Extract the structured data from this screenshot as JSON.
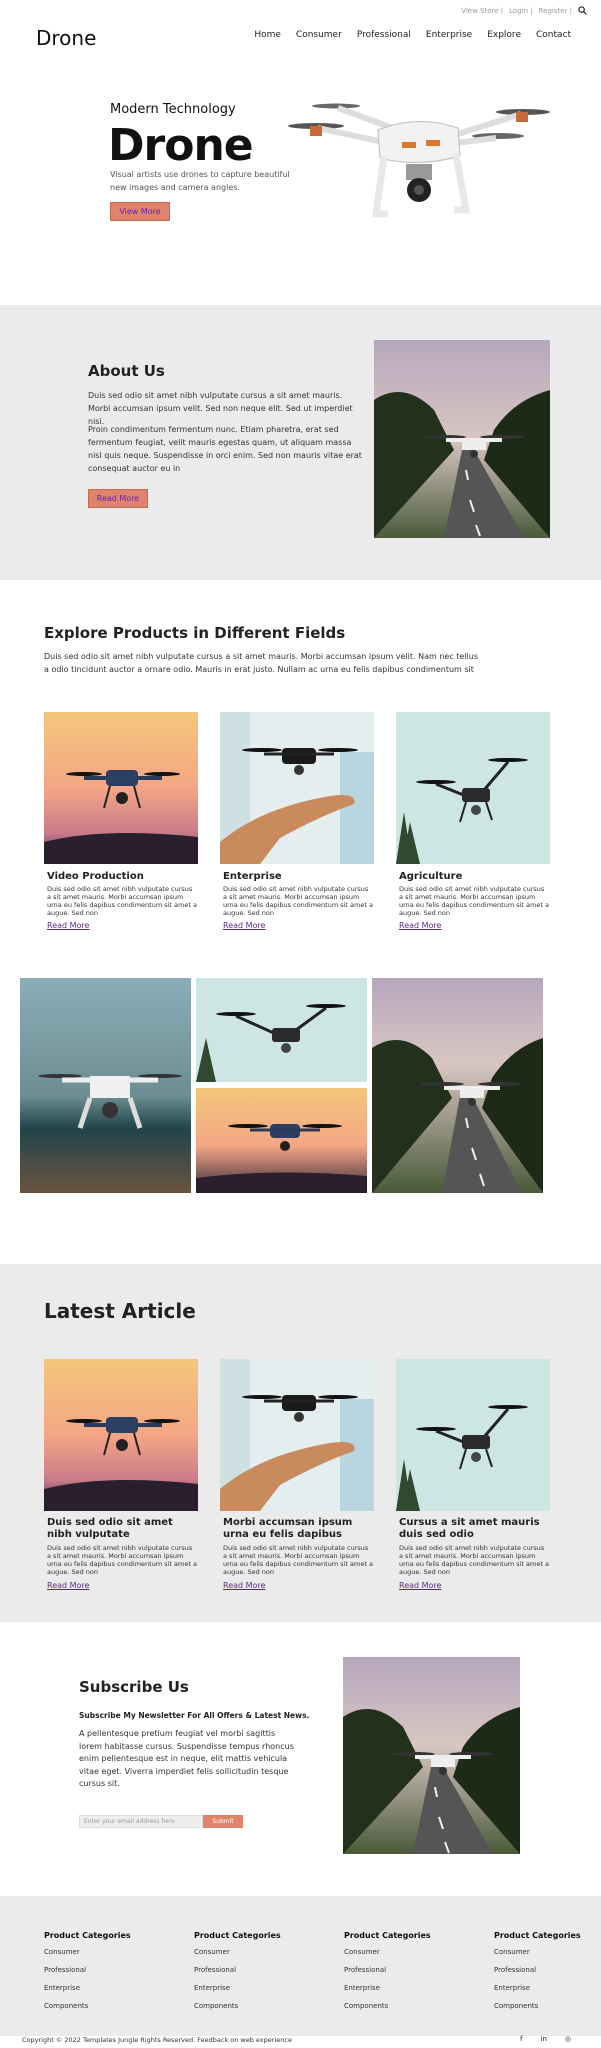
{
  "topbar": {
    "links": [
      "View Store |",
      "Login |",
      "Register |"
    ],
    "icon": "search-icon"
  },
  "brand": "Drone",
  "nav": [
    "Home",
    "Consumer",
    "Professional",
    "Enterprise",
    "Explore",
    "Contact"
  ],
  "hero": {
    "subtitle": "Modern Technology",
    "title": "Drone",
    "description": "Visual artists use drones to capture beautiful new images and camera angles.",
    "button": "View More"
  },
  "about": {
    "title": "About Us",
    "p1": "Duis sed odio sit amet nibh vulputate cursus a sit amet mauris. Morbi accumsan ipsum velit. Sed non neque elit. Sed ut imperdiet nisi.",
    "p2": "Proin condimentum fermentum nunc. Etiam pharetra, erat sed fermentum feugiat, velit mauris egestas quam, ut aliquam massa nisl quis neque. Suspendisse in orci enim. Sed non mauris vitae erat consequat auctor eu in",
    "button": "Read More"
  },
  "explore": {
    "title": "Explore Products in Different Fields",
    "description": "Duis sed odio sit amet nibh vulputate cursus a sit amet mauris. Morbi accumsan ipsum velit. Nam nec tellus a odio tincidunt auctor a ornare odio. Mauris in erat justo. Nullam ac urna eu felis dapibus condimentum sit",
    "cards": [
      {
        "title": "Video Production",
        "text": "Duis sed odio sit amet nibh vulputate cursus a sit amet mauris. Morbi accumsan ipsum urna eu felis dapibus condimentum sit amet a augue. Sed non",
        "link": "Read More"
      },
      {
        "title": "Enterprise",
        "text": "Duis sed odio sit amet nibh vulputate cursus a sit amet mauris. Morbi accumsan ipsum urna eu felis dapibus condimentum sit amet a augue. Sed non",
        "link": "Read More"
      },
      {
        "title": "Agriculture",
        "text": "Duis sed odio sit amet nibh vulputate cursus a sit amet mauris. Morbi accumsan ipsum urna eu felis dapibus condimentum sit amet a augue. Sed non",
        "link": "Read More"
      }
    ]
  },
  "latest": {
    "title": "Latest Article",
    "articles": [
      {
        "title": "Duis sed odio sit amet nibh vulputate",
        "text": "Duis sed odio sit amet nibh vulputate cursus a sit amet mauris. Morbi accumsan ipsum urna eu felis dapibus condimentum sit amet a augue. Sed non",
        "link": "Read More"
      },
      {
        "title": "Morbi accumsan ipsum urna eu felis dapibus",
        "text": "Duis sed odio sit amet nibh vulputate cursus a sit amet mauris. Morbi accumsan ipsum urna eu felis dapibus condimentum sit amet a augue. Sed non",
        "link": "Read More"
      },
      {
        "title": "Cursus a sit amet mauris duis sed odio",
        "text": "Duis sed odio sit amet nibh vulputate cursus a sit amet mauris. Morbi accumsan ipsum urna eu felis dapibus condimentum sit amet a augue. Sed non",
        "link": "Read More"
      }
    ]
  },
  "subscribe": {
    "title": "Subscribe Us",
    "lead": "Subscribe My Newsletter For All Offers & Latest News.",
    "text": "A pellentesque pretium feugiat vel morbi sagittis lorem habitasse cursus. Suspendisse tempus rhoncus enim pellentesque est in neque, elit mattis vehicula vitae eget. Viverra imperdiet felis sollicitudin tesque cursus sit.",
    "placeholder": "Enter your email address here",
    "button": "Submit"
  },
  "footer": {
    "columns": [
      {
        "heading": "Product Categories",
        "items": [
          "Consumer",
          "Professional",
          "Enterprise",
          "Components"
        ]
      },
      {
        "heading": "Product Categories",
        "items": [
          "Consumer",
          "Professional",
          "Enterprise",
          "Components"
        ]
      },
      {
        "heading": "Product Categories",
        "items": [
          "Consumer",
          "Professional",
          "Enterprise",
          "Components"
        ]
      },
      {
        "heading": "Product Categories",
        "items": [
          "Consumer",
          "Professional",
          "Enterprise",
          "Components"
        ]
      }
    ],
    "copyright": "Copyright © 2022 Templates Jungle Rights Reserved. Feedback on web experience",
    "social": [
      "f",
      "in",
      "◎"
    ]
  },
  "colors": {
    "accent": "#e0836c",
    "section_bg": "#ebebeb",
    "link": "#5a2a8a"
  }
}
